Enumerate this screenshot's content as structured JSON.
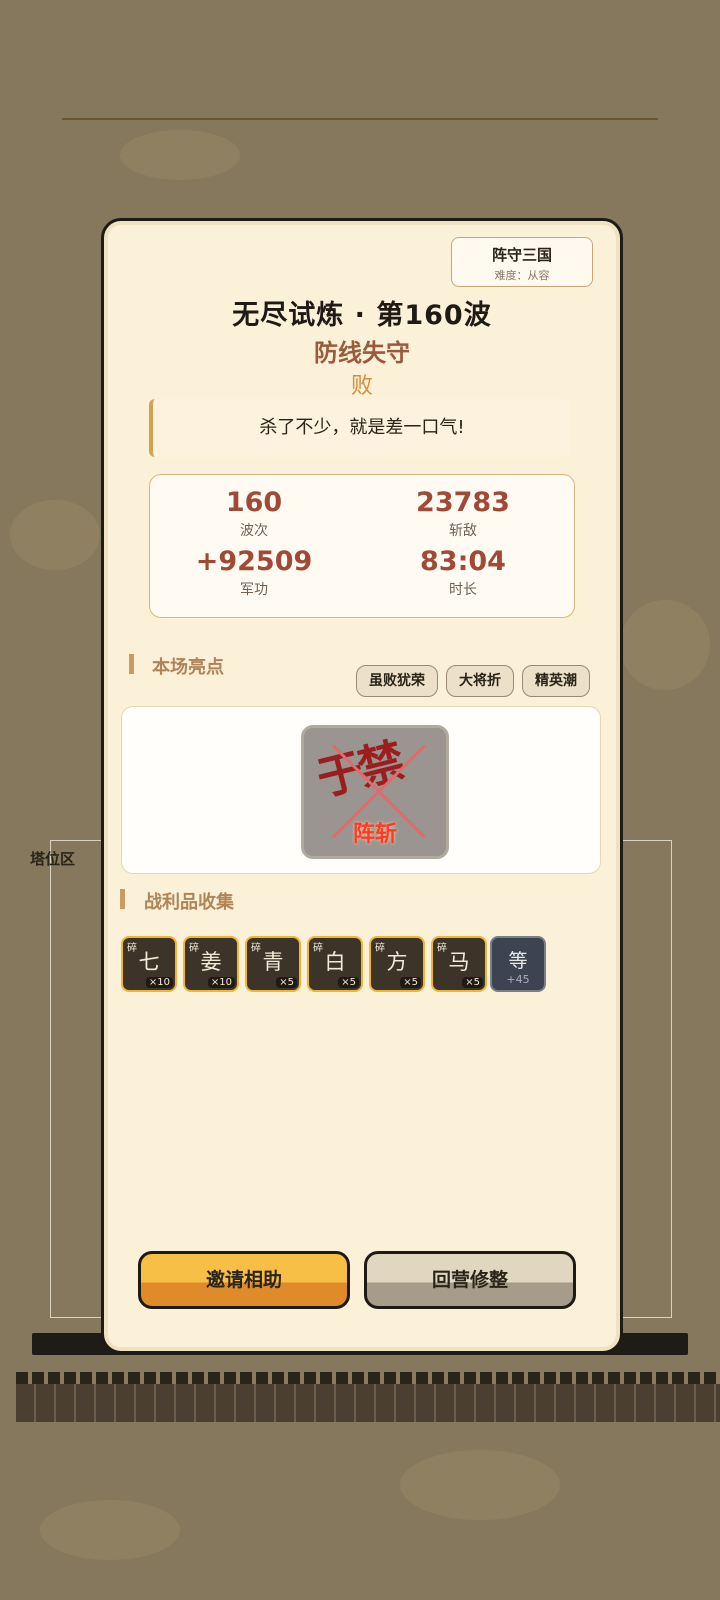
{
  "background": {
    "tower_area_label": "塔位区"
  },
  "badge": {
    "title": "阵守三国",
    "difficulty": "难度：从容"
  },
  "title": "无尽试炼 · 第160波",
  "subtitle": "防线失守",
  "result": "败",
  "quote": "杀了不少，就是差一口气!",
  "stats": [
    {
      "value": "160",
      "label": "波次"
    },
    {
      "value": "23783",
      "label": "斩敌"
    },
    {
      "value": "+92509",
      "label": "军功"
    },
    {
      "value": "83:04",
      "label": "时长"
    }
  ],
  "highlights": {
    "heading": "本场亮点",
    "tags": [
      "虽败犹荣",
      "大将折",
      "精英潮"
    ],
    "card": {
      "name": "于禁",
      "label": "阵斩"
    }
  },
  "loot": {
    "heading": "战利品收集",
    "items": [
      {
        "tag": "碎",
        "char": "七",
        "qty": "×10"
      },
      {
        "tag": "碎",
        "char": "姜",
        "qty": "×10"
      },
      {
        "tag": "碎",
        "char": "青",
        "qty": "×5"
      },
      {
        "tag": "碎",
        "char": "白",
        "qty": "×5"
      },
      {
        "tag": "碎",
        "char": "方",
        "qty": "×5"
      },
      {
        "tag": "碎",
        "char": "马",
        "qty": "×5"
      }
    ],
    "more": {
      "char": "等",
      "count": "+45"
    }
  },
  "buttons": {
    "invite": "邀请相助",
    "retreat": "回营修整"
  },
  "colors": {
    "accent": "#a04a36",
    "gold": "#f1b535",
    "panel": "#fbf0d8"
  }
}
